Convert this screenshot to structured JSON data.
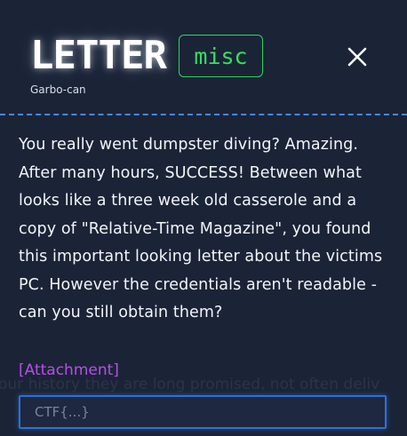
{
  "challenge": {
    "title": "LETTER",
    "author": "Garbo-can",
    "category": "misc",
    "description": "You really went dumpster diving? Amazing. After many hours, SUCCESS! Between what looks like a three week old casserole and a copy of \"Relative-Time Magazine\", you found this important looking letter about the victims PC. However the credentials aren't readable - can you still obtain them?",
    "attachment_label": "[Attachment]"
  },
  "flag_input": {
    "value": "",
    "placeholder": "CTF{...}"
  },
  "background_text": {
    "bottom": "our history they are long promised, not often deliv"
  },
  "icons": {
    "close": "close-icon"
  },
  "colors": {
    "modal_bg": "#1b2437",
    "category_green": "#35e061",
    "divider_blue": "#4b84e8",
    "attachment_purple": "#b84ee8",
    "input_border": "#2f6fd6"
  }
}
